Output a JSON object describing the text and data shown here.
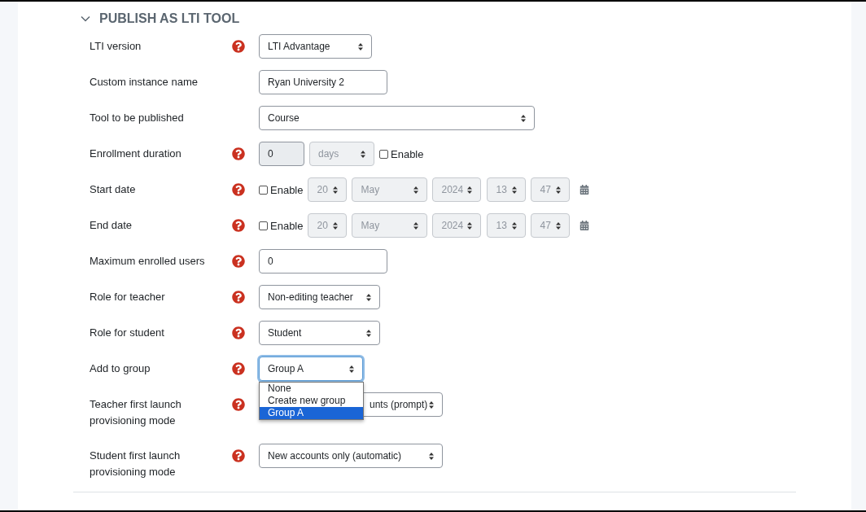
{
  "section": {
    "title": "PUBLISH AS LTI TOOL",
    "expanded": true
  },
  "fields": [
    {
      "kind": "select",
      "label": "LTI version",
      "help": true,
      "disabled": false,
      "value": "LTI Advantage"
    },
    {
      "kind": "text",
      "label": "Custom instance name",
      "help": false,
      "disabled": false,
      "value": "Ryan University 2"
    },
    {
      "kind": "select",
      "label": "Tool to be published",
      "help": false,
      "disabled": false,
      "value": "Course"
    },
    {
      "kind": "duration",
      "label": "Enrollment duration",
      "help": true,
      "disabled": true,
      "value": "0",
      "unit": "days",
      "enable": {
        "label": "Enable",
        "checked": false
      }
    },
    {
      "kind": "date",
      "label": "Start date",
      "help": true,
      "disabled": true,
      "enable": {
        "label": "Enable",
        "checked": false
      },
      "parts": [
        "20",
        "May",
        "2024",
        "13",
        "47"
      ]
    },
    {
      "kind": "date",
      "label": "End date",
      "help": true,
      "disabled": true,
      "enable": {
        "label": "Enable",
        "checked": false
      },
      "parts": [
        "20",
        "May",
        "2024",
        "13",
        "47"
      ]
    },
    {
      "kind": "text",
      "label": "Maximum enrolled users",
      "help": true,
      "disabled": false,
      "value": "0"
    },
    {
      "kind": "select",
      "label": "Role for teacher",
      "help": true,
      "disabled": false,
      "value": "Non-editing teacher"
    },
    {
      "kind": "select",
      "label": "Role for student",
      "help": true,
      "disabled": false,
      "value": "Student"
    },
    {
      "kind": "select",
      "label": "Add to group",
      "help": true,
      "disabled": false,
      "value": "Group A",
      "focused": true,
      "options": [
        {
          "label": "None",
          "selected": false
        },
        {
          "label": "Create new group",
          "selected": false
        },
        {
          "label": "Group A",
          "selected": true
        }
      ]
    },
    {
      "kind": "select",
      "label": "Teacher first launch provisioning mode",
      "help": true,
      "disabled": false,
      "value": "unts (prompt)",
      "covered": true
    },
    {
      "kind": "select",
      "label": "Student first launch provisioning mode",
      "help": true,
      "disabled": false,
      "value": "New accounts only (automatic)"
    }
  ]
}
